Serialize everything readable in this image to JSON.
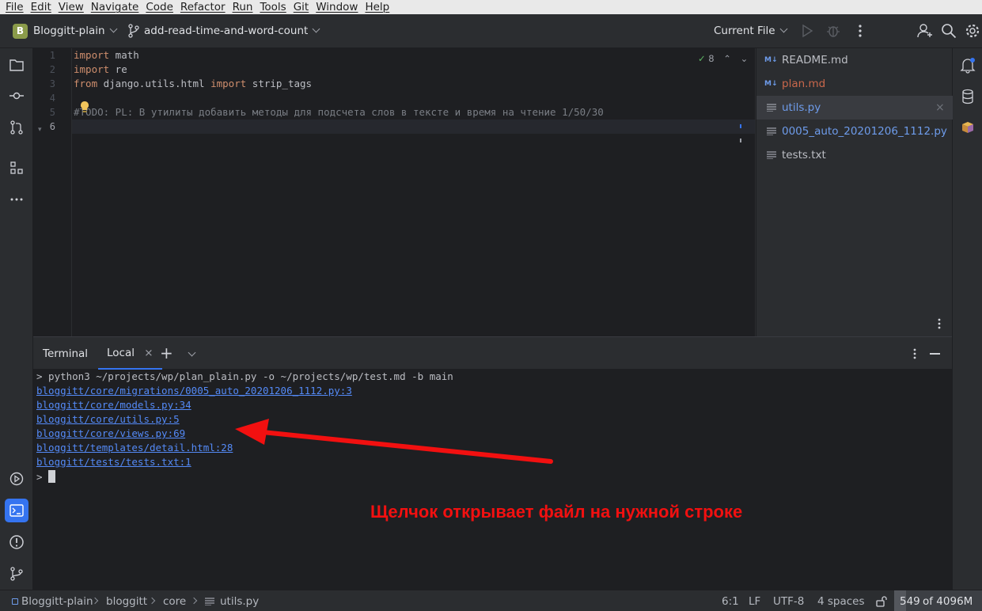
{
  "menu": [
    "File",
    "Edit",
    "View",
    "Navigate",
    "Code",
    "Refactor",
    "Run",
    "Tools",
    "Git",
    "Window",
    "Help"
  ],
  "toolbar": {
    "project_initial": "B",
    "project_name": "Bloggitt-plain",
    "branch": "add-read-time-and-word-count",
    "run_config": "Current File"
  },
  "editor": {
    "line_numbers": [
      "1",
      "2",
      "3",
      "4",
      "5",
      "6"
    ],
    "lines": {
      "l1_kw": "import",
      "l1_rest": " math",
      "l2_kw": "import",
      "l2_rest": " re",
      "l3_kw1": "from",
      "l3_mid": " django.utils.html ",
      "l3_kw2": "import",
      "l3_rest": " strip_tags",
      "l5_hash": "#",
      "l5_text": "TODO: PL: В утилиты добавить методы для подсчета слов в тексте и время на чтение 1/50/30"
    },
    "inspection_count": "8"
  },
  "files": [
    {
      "name": "README.md",
      "icon": "markdown-icon",
      "color": "#bcbec4"
    },
    {
      "name": "plan.md",
      "icon": "markdown-icon",
      "color": "#c9674b"
    },
    {
      "name": "utils.py",
      "icon": "text-file-icon",
      "color": "#6e9ceb",
      "selected": true
    },
    {
      "name": "0005_auto_20201206_1112.py",
      "icon": "text-file-icon",
      "color": "#6e9ceb"
    },
    {
      "name": "tests.txt",
      "icon": "text-file-icon",
      "color": "#bcbec4"
    }
  ],
  "terminal": {
    "title": "Terminal",
    "tab": "Local",
    "command": "> python3 ~/projects/wp/plan_plain.py -o ~/projects/wp/test.md -b main",
    "links": [
      "bloggitt/core/migrations/0005_auto_20201206_1112.py:3",
      "bloggitt/core/models.py:34",
      "bloggitt/core/utils.py:5",
      "bloggitt/core/views.py:69",
      "bloggitt/templates/detail.html:28",
      "bloggitt/tests/tests.txt:1"
    ],
    "prompt": "> ",
    "annotation": "Щелчок открывает файл на нужной строке"
  },
  "statusbar": {
    "crumbs": [
      "Bloggitt-plain",
      "bloggitt",
      "core",
      "utils.py"
    ],
    "position": "6:1",
    "line_sep": "LF",
    "encoding": "UTF-8",
    "indent": "4 spaces",
    "memory_used": "549",
    "memory_total": "of 4096M",
    "memory_fraction": 0.134
  }
}
